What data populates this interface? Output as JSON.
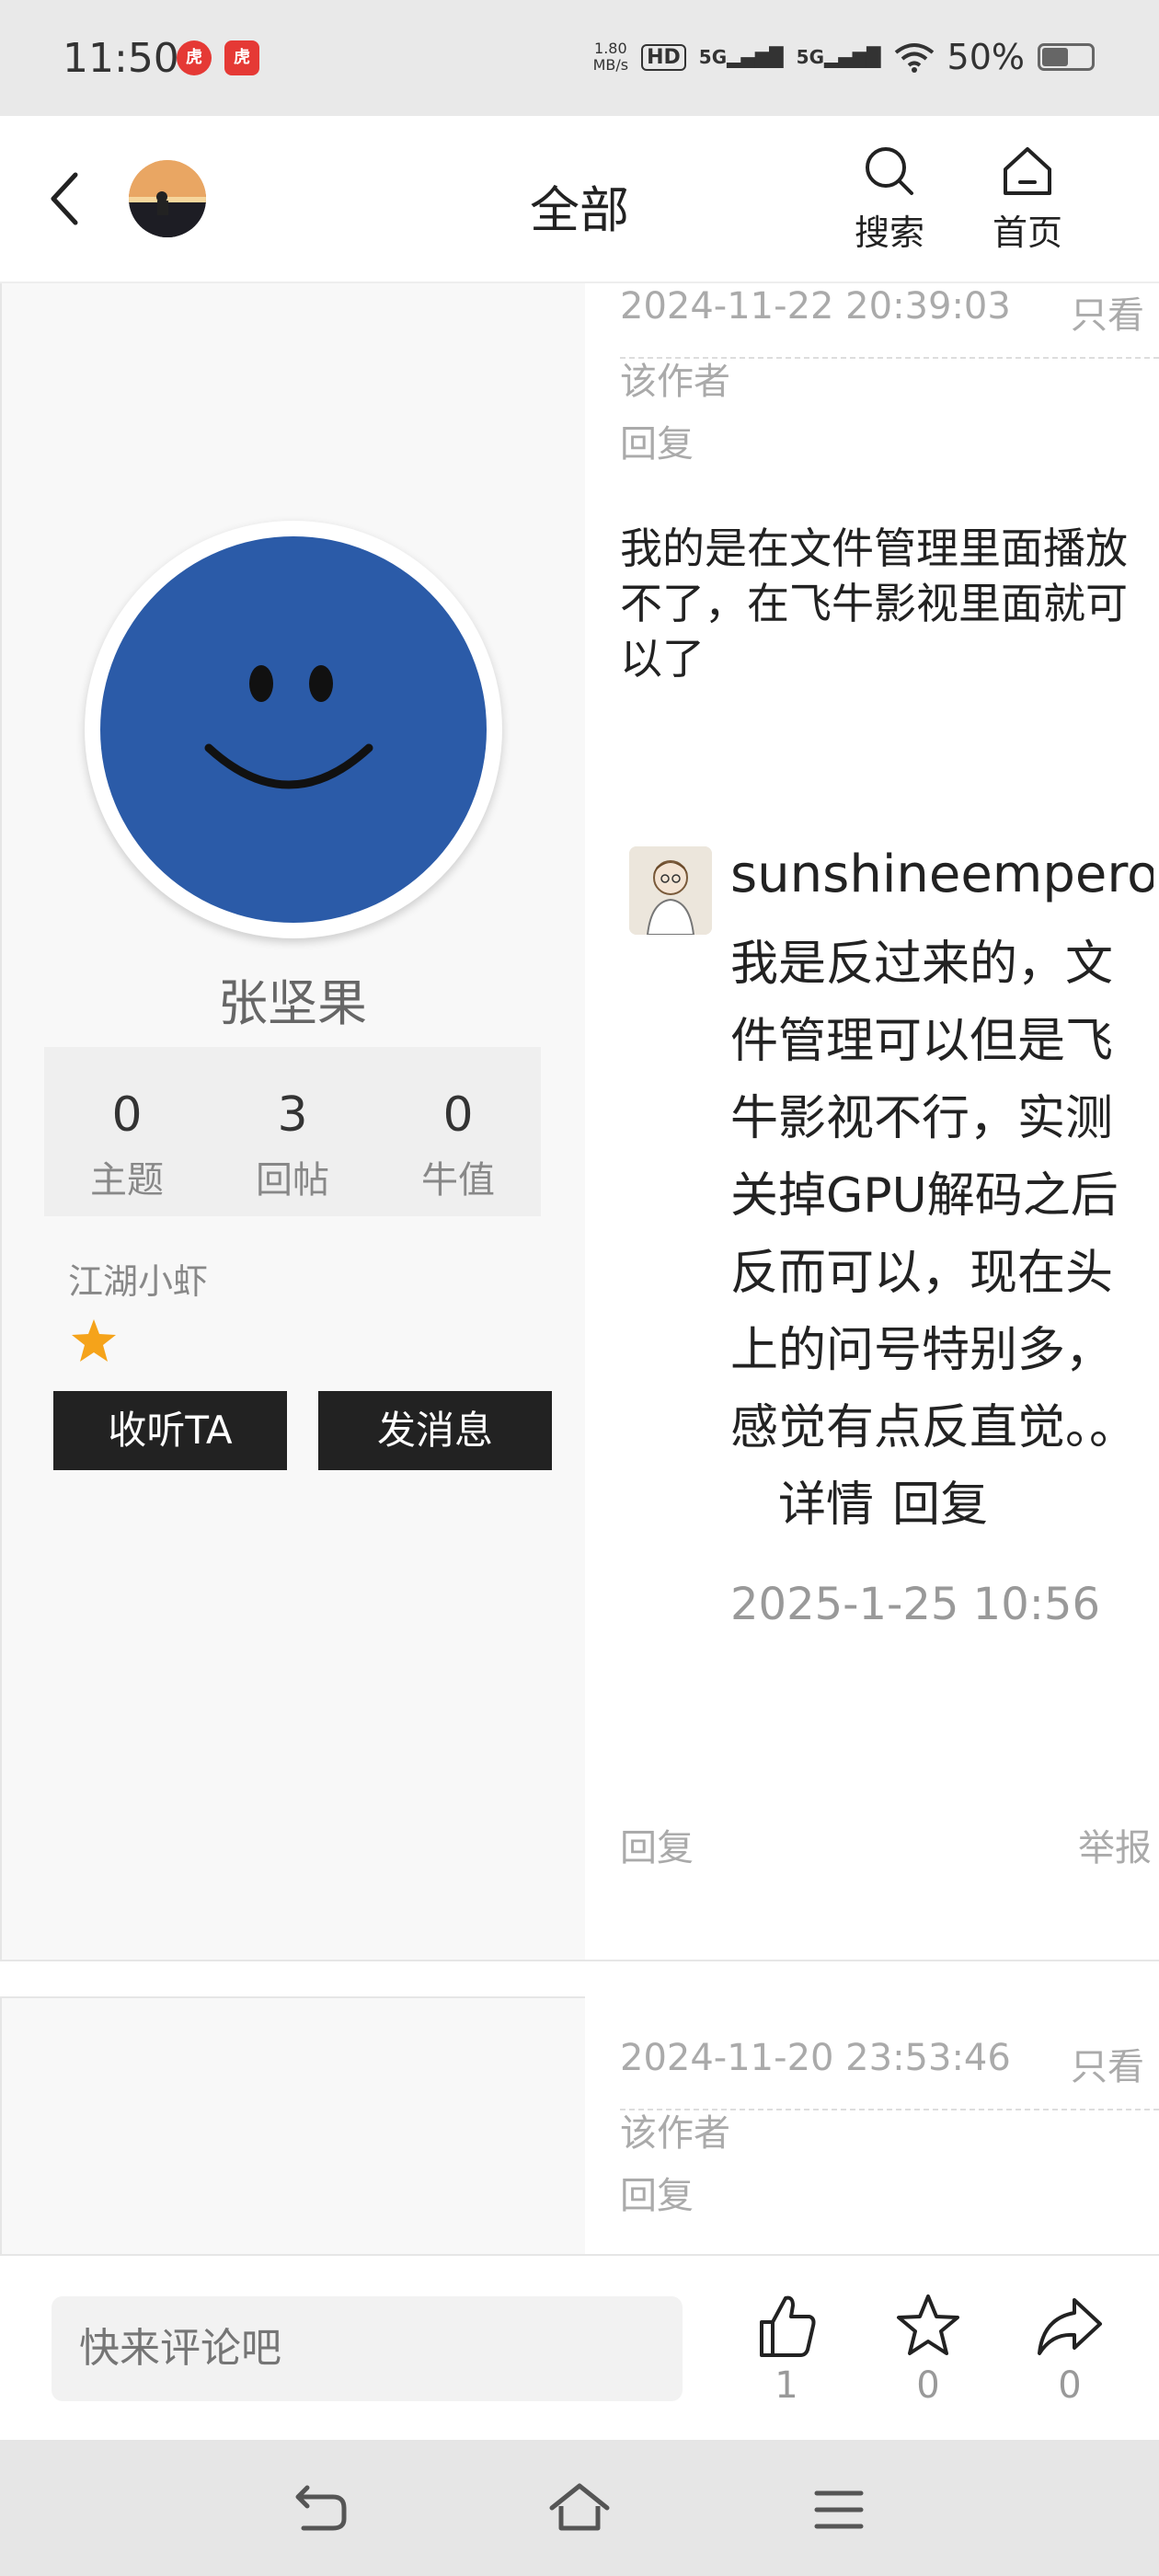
{
  "status_bar": {
    "time": "11:50",
    "app_icons": [
      "hupu-icon",
      "hupu-icon"
    ],
    "net_speed_value": "1.80",
    "net_speed_unit": "MB/s",
    "hd_label": "HD",
    "signal_labels": [
      "5G",
      "5G"
    ],
    "battery": "50%"
  },
  "header": {
    "title": "全部",
    "search_label": "搜索",
    "home_label": "首页"
  },
  "author": {
    "name": "张坚果",
    "stats": [
      {
        "value": "0",
        "label": "主题"
      },
      {
        "value": "3",
        "label": "回帖"
      },
      {
        "value": "0",
        "label": "牛值"
      }
    ],
    "rank": "江湖小虾",
    "follow_label": "收听TA",
    "message_label": "发消息"
  },
  "post1": {
    "timestamp": "2024-11-22 20:39:03",
    "only_author_a": "只看",
    "only_author_b": "该作者",
    "reply_label": "回复",
    "body": "我的是在文件管理里面播放不了，在飞牛影视里面就可以了",
    "reply": {
      "user": "sunshineemperor",
      "body": "我是反过来的，文件管理可以但是飞牛影视不行，实测关掉GPU解码之后反而可以，现在头上的问号特别多，感觉有点反直觉。。",
      "details_label": "详情",
      "reply_label": "回复",
      "time": "2025-1-25 10:56"
    },
    "footer_reply_label": "回复",
    "report_label": "举报"
  },
  "post2": {
    "timestamp": "2024-11-20 23:53:46",
    "only_author_a": "只看",
    "only_author_b": "该作者",
    "reply_label": "回复"
  },
  "comment_bar": {
    "placeholder": "快来评论吧",
    "like_count": "1",
    "favorite_count": "0",
    "share_count": "0"
  },
  "colors": {
    "accent_dark": "#222222",
    "star": "#f5a31a",
    "avatar_blue": "#2b5ba8"
  }
}
